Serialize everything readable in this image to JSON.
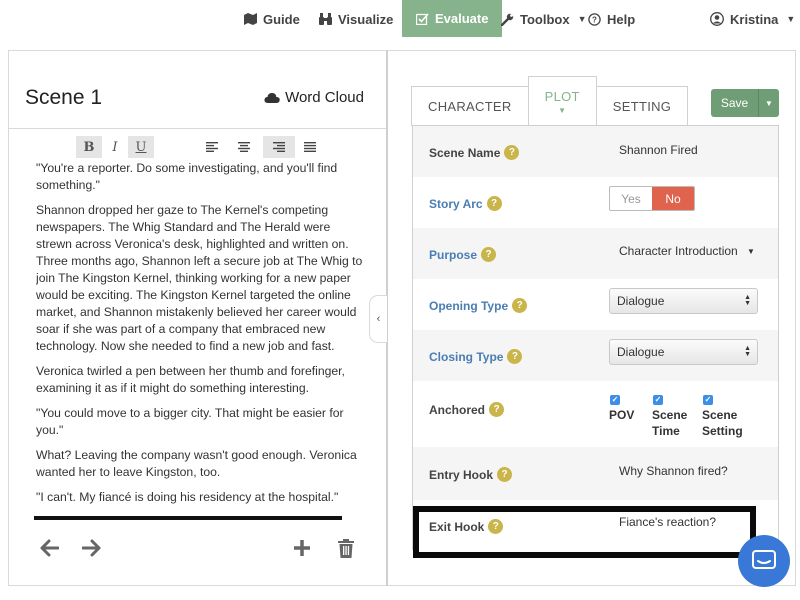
{
  "nav": {
    "guide": "Guide",
    "visualize": "Visualize",
    "evaluate": "Evaluate",
    "toolbox": "Toolbox",
    "help": "Help",
    "user": "Kristina"
  },
  "editor": {
    "scene_title": "Scene 1",
    "word_cloud": "Word Cloud",
    "format_buttons": [
      "B",
      "I",
      "U"
    ],
    "paragraphs": [
      "\"You're a reporter. Do some investigating, and you'll find something.\"",
      "Shannon dropped her gaze to The Kernel's competing newspapers. The Whig Standard and The Herald were strewn across Veronica's desk, highlighted and written on. Three months ago, Shannon left a secure job at The Whig to join The Kingston Kernel, thinking working for a new paper would be exciting. The Kingston Kernel targeted the online market, and Shannon mistakenly believed her career would soar if she was part of a company that embraced new technology. Now she needed to find a new job and fast.",
      "Veronica twirled a pen between her thumb and forefinger, examining it as if it might do something interesting.",
      "\"You could move to a bigger city. That might be easier for you.\"",
      "What? Leaving the company wasn't good enough. Veronica wanted her to leave Kingston, too.",
      "\"I can't. My fiancé is doing his residency at the hospital.\""
    ]
  },
  "tabs": [
    "CHARACTER",
    "PLOT",
    "SETTING"
  ],
  "save": {
    "label": "Save"
  },
  "fields": {
    "scene_name": {
      "label": "Scene Name",
      "value": "Shannon Fired"
    },
    "story_arc": {
      "label": "Story Arc",
      "yes": "Yes",
      "no": "No",
      "selected": "No"
    },
    "purpose": {
      "label": "Purpose",
      "value": "Character Introduction"
    },
    "opening_type": {
      "label": "Opening Type",
      "value": "Dialogue"
    },
    "closing_type": {
      "label": "Closing Type",
      "value": "Dialogue"
    },
    "anchored": {
      "label": "Anchored",
      "options": [
        {
          "line1": "POV",
          "line2": ""
        },
        {
          "line1": "Scene",
          "line2": "Time"
        },
        {
          "line1": "Scene",
          "line2": "Setting"
        }
      ]
    },
    "entry_hook": {
      "label": "Entry Hook",
      "value": "Why Shannon fired?"
    },
    "exit_hook": {
      "label": "Exit Hook",
      "value": "Fiance's reaction?"
    }
  },
  "colors": {
    "accent_green": "#86b38b",
    "save_green": "#6f9d75",
    "no_red": "#e0634d",
    "link_blue": "#4a7db3",
    "help_gold": "#c9b54a",
    "chat_blue": "#3a78d8"
  }
}
